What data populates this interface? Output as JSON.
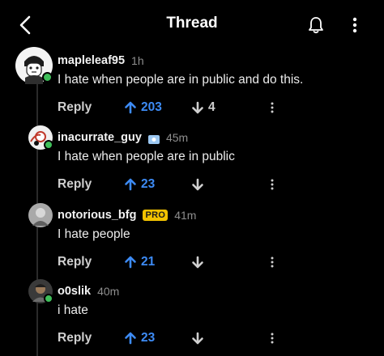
{
  "header": {
    "title": "Thread",
    "back_icon": "chevron-left-icon",
    "bell_icon": "bell-icon",
    "more_icon": "vertical-dots-icon"
  },
  "colors": {
    "background": "#000000",
    "upvote": "#3d8bf5",
    "online": "#3fbf5a",
    "pro_badge": "#f2c200"
  },
  "comments": [
    {
      "username": "mapleleaf95",
      "time": "1h",
      "text": "I hate when people are in public and do this.",
      "reply_label": "Reply",
      "upvotes": "203",
      "downvotes": "4"
    },
    {
      "username": "inacurrate_guy",
      "time": "45m",
      "flair_icon": "flag-icon",
      "text": "I hate when people are in public",
      "reply_label": "Reply",
      "upvotes": "23",
      "downvotes": ""
    },
    {
      "username": "notorious_bfg",
      "badge": "PRO",
      "time": "41m",
      "text": "I hate people",
      "reply_label": "Reply",
      "upvotes": "21",
      "downvotes": ""
    },
    {
      "username": "o0slik",
      "time": "40m",
      "text": "i hate",
      "reply_label": "Reply",
      "upvotes": "23",
      "downvotes": ""
    }
  ]
}
